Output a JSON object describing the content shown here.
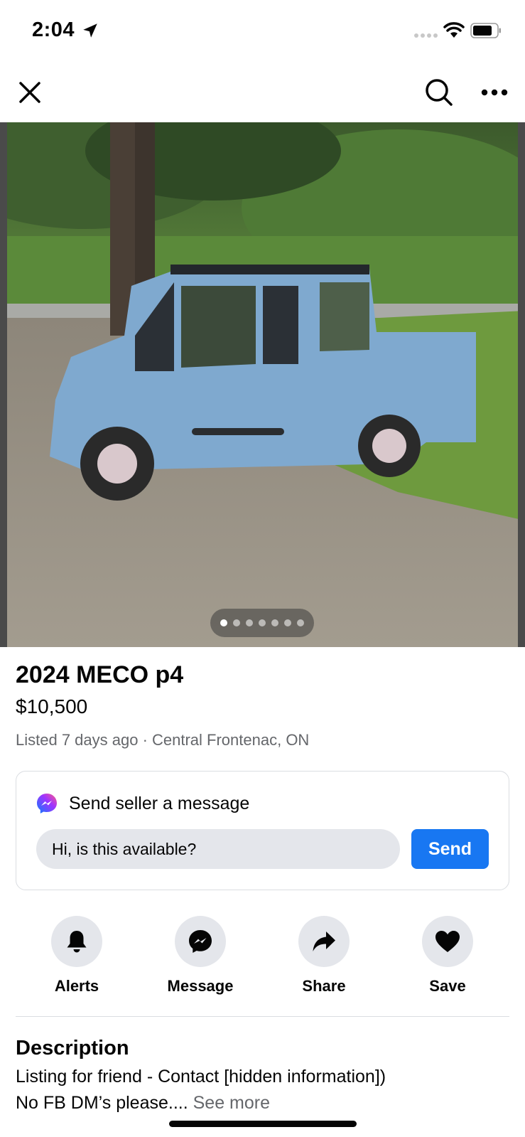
{
  "status_bar": {
    "time": "2:04",
    "icons": [
      "location-arrow-icon",
      "signal-icon",
      "wifi-icon",
      "battery-icon"
    ]
  },
  "nav": {
    "icons": [
      "close-icon",
      "search-icon",
      "more-icon"
    ]
  },
  "photo": {
    "total_images": 7,
    "active_index": 0
  },
  "listing": {
    "title": "2024 MECO p4",
    "price": "$10,500",
    "meta": "Listed 7 days ago · Central Frontenac, ON"
  },
  "message_card": {
    "heading": "Send seller a message",
    "input_value": "Hi, is this available?",
    "send_label": "Send"
  },
  "actions": [
    {
      "label": "Alerts",
      "icon": "bell-icon"
    },
    {
      "label": "Message",
      "icon": "messenger-icon"
    },
    {
      "label": "Share",
      "icon": "share-arrow-icon"
    },
    {
      "label": "Save",
      "icon": "heart-icon"
    }
  ],
  "description": {
    "heading": "Description",
    "line1": "Listing for friend - Contact [hidden information])",
    "line2": "No FB DM’s please.... ",
    "see_more": "See more"
  },
  "colors": {
    "accent": "#1877f2",
    "secondary_text": "#65676b",
    "button_bg": "#e4e6eb"
  }
}
